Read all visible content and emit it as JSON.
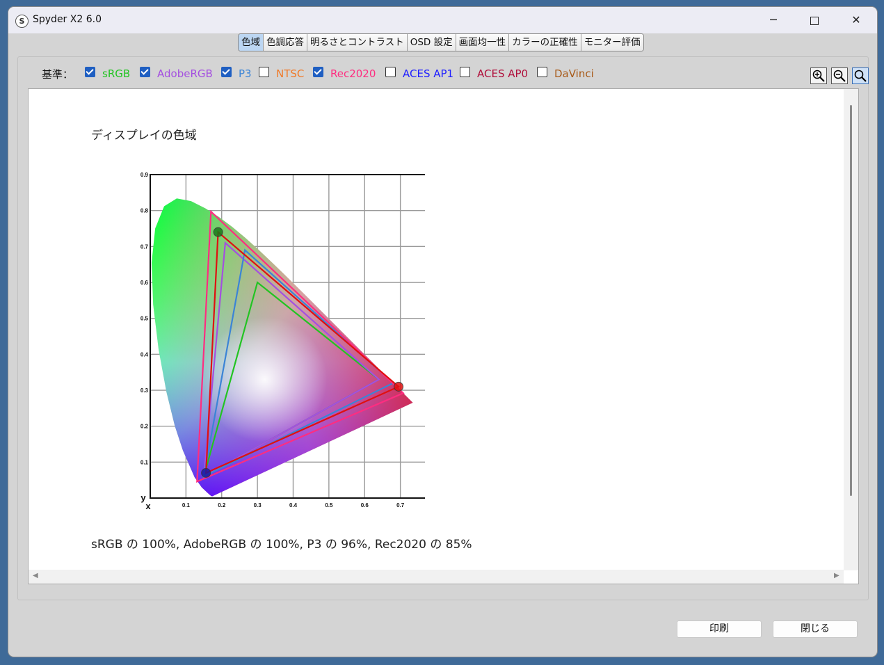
{
  "window": {
    "title": "Spyder X2 6.0",
    "minimize": "─",
    "close": "✕"
  },
  "tabs": [
    {
      "label": "色域",
      "active": true
    },
    {
      "label": "色調応答",
      "active": false
    },
    {
      "label": "明るさとコントラスト",
      "active": false
    },
    {
      "label": "OSD 設定",
      "active": false
    },
    {
      "label": "画面均一性",
      "active": false
    },
    {
      "label": "カラーの正確性",
      "active": false
    },
    {
      "label": "モニター評価",
      "active": false
    }
  ],
  "reference": {
    "label": "基準：",
    "items": [
      {
        "label": "sRGB",
        "checked": true,
        "color": "#22c422"
      },
      {
        "label": "AdobeRGB",
        "checked": true,
        "color": "#a44fe0"
      },
      {
        "label": "P3",
        "checked": true,
        "color": "#3b84d6"
      },
      {
        "label": "NTSC",
        "checked": false,
        "color": "#f07a28"
      },
      {
        "label": "Rec2020",
        "checked": true,
        "color": "#ff2d80"
      },
      {
        "label": "ACES AP1",
        "checked": false,
        "color": "#2020ff"
      },
      {
        "label": "ACES AP0",
        "checked": false,
        "color": "#b0103c"
      },
      {
        "label": "DaVinci",
        "checked": false,
        "color": "#a85a18"
      }
    ]
  },
  "zoom_buttons": [
    {
      "name": "zoom-in-icon"
    },
    {
      "name": "zoom-out-icon"
    },
    {
      "name": "zoom-fit-icon",
      "selected": true
    }
  ],
  "section_title": "ディスプレイの色域",
  "result_text": "sRGB の 100%, AdobeRGB の 100%, P3 の 96%, Rec2020 の 85%",
  "chart_data": {
    "type": "scatter",
    "title": "",
    "xlabel": "x",
    "ylabel": "y",
    "xlim": [
      0,
      0.8
    ],
    "ylim": [
      0,
      0.9
    ],
    "xticks": [
      "0.1",
      "0.2",
      "0.3",
      "0.4",
      "0.5",
      "0.6",
      "0.7",
      "0.8"
    ],
    "yticks": [
      "0.1",
      "0.2",
      "0.3",
      "0.4",
      "0.5",
      "0.6",
      "0.7",
      "0.8",
      "0.9"
    ],
    "grid": true,
    "locus": [
      [
        0.1741,
        0.005
      ],
      [
        0.1738,
        0.0049
      ],
      [
        0.1703,
        0.0058
      ],
      [
        0.1666,
        0.0089
      ],
      [
        0.1611,
        0.0138
      ],
      [
        0.144,
        0.0297
      ],
      [
        0.1241,
        0.0578
      ],
      [
        0.0913,
        0.1327
      ],
      [
        0.0687,
        0.2007
      ],
      [
        0.0454,
        0.295
      ],
      [
        0.0235,
        0.4127
      ],
      [
        0.0082,
        0.5384
      ],
      [
        0.0039,
        0.6548
      ],
      [
        0.0139,
        0.7502
      ],
      [
        0.0389,
        0.812
      ],
      [
        0.0743,
        0.8338
      ],
      [
        0.1142,
        0.8262
      ],
      [
        0.1547,
        0.8059
      ],
      [
        0.1929,
        0.7816
      ],
      [
        0.2296,
        0.7543
      ],
      [
        0.2658,
        0.7243
      ],
      [
        0.3016,
        0.6923
      ],
      [
        0.3373,
        0.6589
      ],
      [
        0.3731,
        0.6245
      ],
      [
        0.4087,
        0.5896
      ],
      [
        0.4441,
        0.5547
      ],
      [
        0.4788,
        0.5202
      ],
      [
        0.5125,
        0.4866
      ],
      [
        0.5448,
        0.4544
      ],
      [
        0.5752,
        0.4242
      ],
      [
        0.6029,
        0.3965
      ],
      [
        0.627,
        0.3725
      ],
      [
        0.6482,
        0.3514
      ],
      [
        0.6658,
        0.334
      ],
      [
        0.6801,
        0.3197
      ],
      [
        0.6915,
        0.3083
      ],
      [
        0.7006,
        0.2993
      ],
      [
        0.714,
        0.2859
      ],
      [
        0.7347,
        0.2653
      ]
    ],
    "series": [
      {
        "name": "sRGB",
        "color": "#22c422",
        "points": [
          [
            0.64,
            0.33
          ],
          [
            0.3,
            0.6
          ],
          [
            0.15,
            0.06
          ]
        ]
      },
      {
        "name": "AdobeRGB",
        "color": "#a44fe0",
        "points": [
          [
            0.64,
            0.33
          ],
          [
            0.21,
            0.71
          ],
          [
            0.15,
            0.06
          ]
        ]
      },
      {
        "name": "P3",
        "color": "#3b84d6",
        "points": [
          [
            0.68,
            0.32
          ],
          [
            0.265,
            0.69
          ],
          [
            0.15,
            0.06
          ]
        ]
      },
      {
        "name": "Rec2020",
        "color": "#ff2d80",
        "points": [
          [
            0.708,
            0.292
          ],
          [
            0.17,
            0.797
          ],
          [
            0.131,
            0.046
          ]
        ]
      },
      {
        "color": "#e01010",
        "points": [
          [
            0.695,
            0.31
          ],
          [
            0.19,
            0.74
          ],
          [
            0.156,
            0.07
          ]
        ]
      }
    ],
    "markers": [
      {
        "color": "#e01010",
        "point": [
          0.695,
          0.31
        ]
      },
      {
        "color": "#1a7a1a",
        "point": [
          0.19,
          0.74
        ]
      },
      {
        "color": "#1a1aa0",
        "point": [
          0.156,
          0.07
        ]
      }
    ]
  },
  "buttons": {
    "print": "印刷",
    "close": "閉じる"
  }
}
